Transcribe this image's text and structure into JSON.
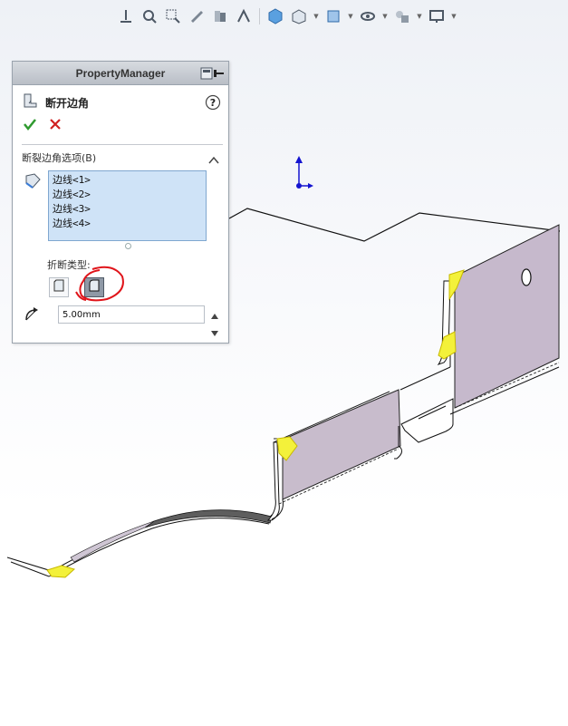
{
  "toolbar": {
    "icons": [
      "view-orientation-icon",
      "zoom-to-fit-icon",
      "zoom-area-icon",
      "previous-view-icon",
      "section-view-icon",
      "dynamic-annotation-icon",
      "isometric-view-icon",
      "display-style-icon",
      "hide-show-icon",
      "edit-appearance-icon",
      "apply-scene-icon",
      "view-settings-icon"
    ]
  },
  "property_manager": {
    "title": "PropertyManager",
    "feature_name": "断开边角",
    "ok_icon": "checkmark-icon",
    "cancel_icon": "cancel-x-icon",
    "group_title": "断裂边角选项(B)",
    "edges": [
      "边线<1>",
      "边线<2>",
      "边线<3>",
      "边线<4>"
    ],
    "break_type_label": "折断类型:",
    "break_types": [
      "chamfer-break-icon",
      "fillet-break-icon"
    ],
    "selected_break_type": "fillet-break-icon",
    "distance_value": "5.00mm"
  },
  "colors": {
    "panel_header": "#c3c8cf",
    "list_bg": "#cfe3f7",
    "flange_face": "#c6b9cc",
    "selection_highlight": "#f3f13a",
    "annotation_red": "#e0141a",
    "ok_green": "#2f9a2f",
    "cancel_red": "#d02020"
  }
}
